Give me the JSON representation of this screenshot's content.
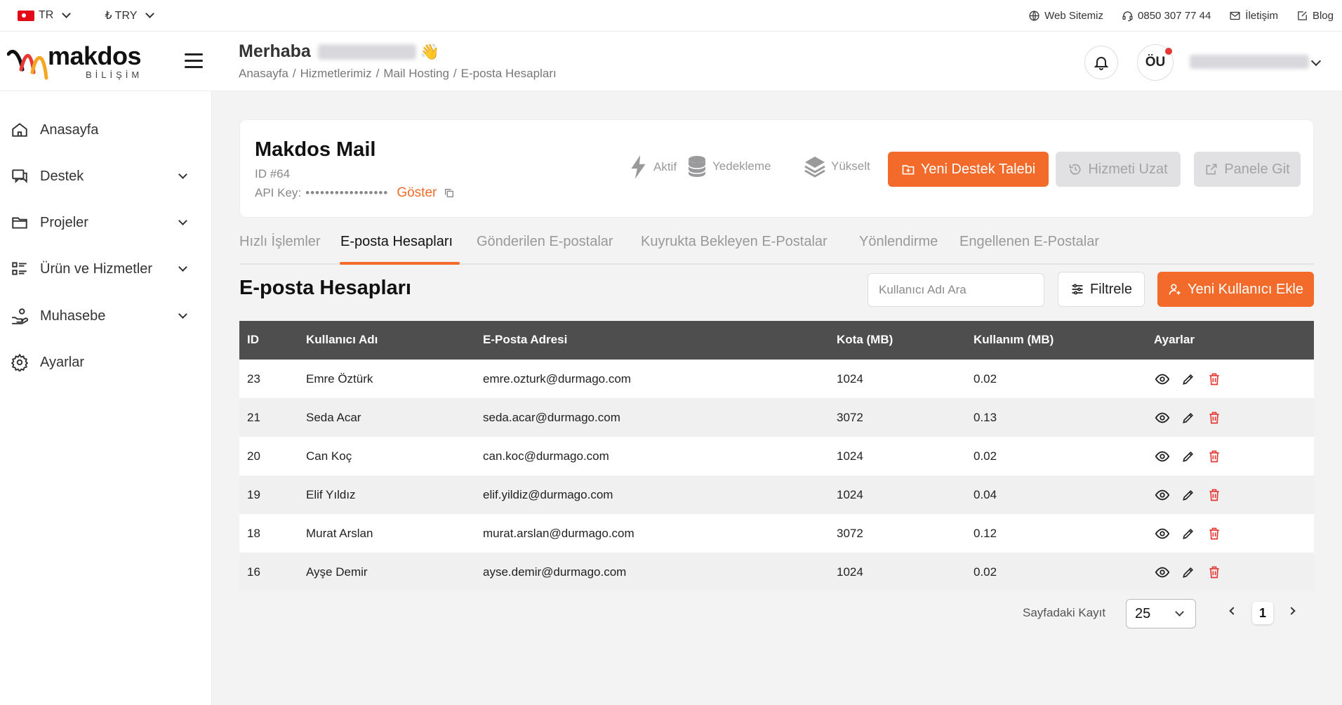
{
  "topbar": {
    "language": "TR",
    "currency": "₺ TRY",
    "links": {
      "website": "Web Sitemiz",
      "phone": "0850 307 77 44",
      "contact": "İletişim",
      "blog": "Blog"
    }
  },
  "brand": {
    "name": "makdos",
    "sub": "BİLİŞİM",
    "colors": {
      "accent": "#f26b2a",
      "table_header": "#4e4e4f"
    }
  },
  "header": {
    "greeting": "Merhaba",
    "wave": "👋",
    "breadcrumb": [
      "Anasayfa",
      "Hizmetlerimiz",
      "Mail Hosting",
      "E-posta Hesapları"
    ],
    "avatar_initials": "ÖU"
  },
  "sidebar": {
    "items": [
      {
        "label": "Anasayfa",
        "icon": "home-icon",
        "has_children": false
      },
      {
        "label": "Destek",
        "icon": "chat-icon",
        "has_children": true
      },
      {
        "label": "Projeler",
        "icon": "folder-icon",
        "has_children": true
      },
      {
        "label": "Ürün ve Hizmetler",
        "icon": "list-icon",
        "has_children": true
      },
      {
        "label": "Muhasebe",
        "icon": "hand-coins-icon",
        "has_children": true
      },
      {
        "label": "Ayarlar",
        "icon": "gear-icon",
        "has_children": false
      }
    ]
  },
  "service": {
    "title": "Makdos Mail",
    "id_text": "ID #64",
    "api_label": "API Key:",
    "api_mask": "•••••••••••••••••",
    "show_label": "Göster",
    "stats": {
      "status": "Aktif",
      "backup": "Yedekleme",
      "upgrade": "Yükselt"
    },
    "buttons": {
      "new_ticket": "Yeni Destek Talebi",
      "extend": "Hizmeti Uzat",
      "go_panel": "Panele Git"
    }
  },
  "tabs": [
    {
      "label": "Hızlı İşlemler",
      "active": false
    },
    {
      "label": "E-posta Hesapları",
      "active": true
    },
    {
      "label": "Gönderilen E-postalar",
      "active": false
    },
    {
      "label": "Kuyrukta Bekleyen E-Postalar",
      "active": false
    },
    {
      "label": "Yönlendirme",
      "active": false
    },
    {
      "label": "Engellenen E-Postalar",
      "active": false
    }
  ],
  "section": {
    "title": "E-posta Hesapları",
    "search_placeholder": "Kullanıcı Adı Ara",
    "filter_label": "Filtrele",
    "add_user_label": "Yeni Kullanıcı Ekle"
  },
  "table": {
    "columns": [
      "ID",
      "Kullanıcı Adı",
      "E-Posta Adresi",
      "Kota (MB)",
      "Kullanım (MB)",
      "Ayarlar"
    ],
    "rows": [
      {
        "id": "23",
        "user": "Emre Öztürk",
        "email": "emre.ozturk@durmago.com",
        "quota": "1024",
        "usage": "0.02"
      },
      {
        "id": "21",
        "user": "Seda Acar",
        "email": "seda.acar@durmago.com",
        "quota": "3072",
        "usage": "0.13"
      },
      {
        "id": "20",
        "user": "Can Koç",
        "email": "can.koc@durmago.com",
        "quota": "1024",
        "usage": "0.02"
      },
      {
        "id": "19",
        "user": "Elif Yıldız",
        "email": "elif.yildiz@durmago.com",
        "quota": "1024",
        "usage": "0.04"
      },
      {
        "id": "18",
        "user": "Murat Arslan",
        "email": "murat.arslan@durmago.com",
        "quota": "3072",
        "usage": "0.12"
      },
      {
        "id": "16",
        "user": "Ayşe Demir",
        "email": "ayse.demir@durmago.com",
        "quota": "1024",
        "usage": "0.02"
      }
    ]
  },
  "pagination": {
    "per_page_label": "Sayfadaki Kayıt",
    "per_page_value": "25",
    "current_page": "1"
  }
}
